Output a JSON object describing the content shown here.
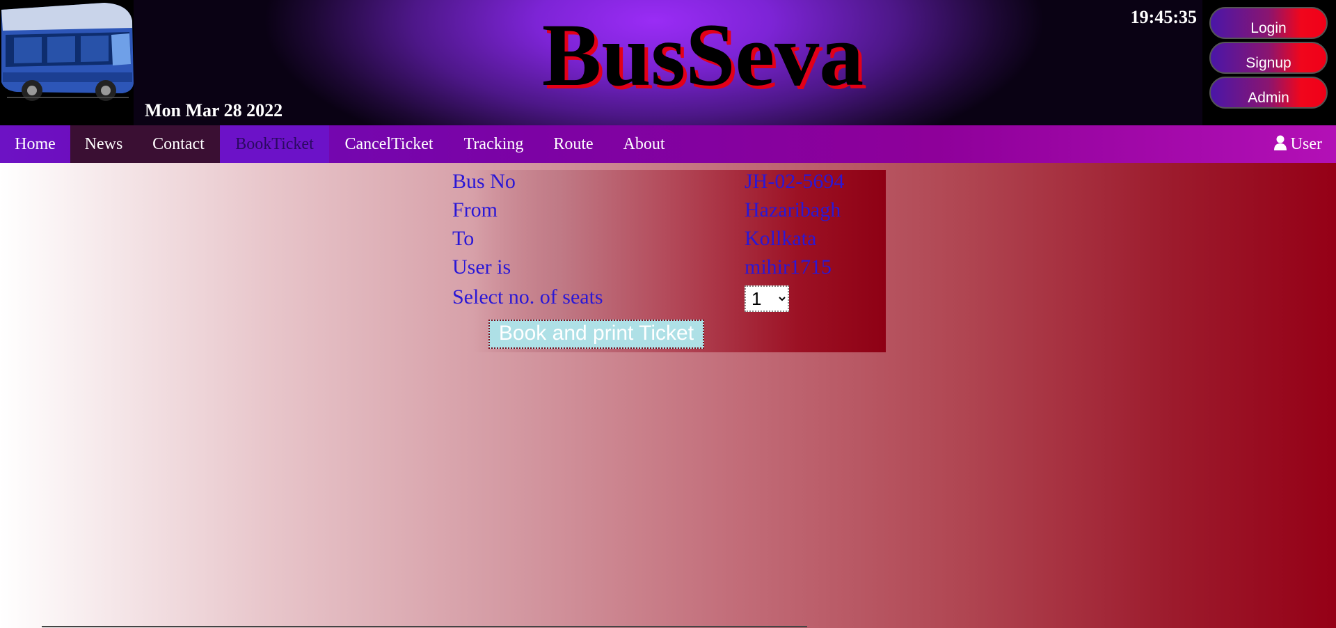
{
  "header": {
    "brand": "BusSeva",
    "date": "Mon Mar 28 2022",
    "clock": "19:45:35",
    "logo_icon": "bus-icon"
  },
  "auth": {
    "login": "Login",
    "signup": "Signup",
    "admin": "Admin"
  },
  "nav": {
    "items": [
      {
        "label": "Home"
      },
      {
        "label": "News"
      },
      {
        "label": "Contact"
      },
      {
        "label": "BookTicket"
      },
      {
        "label": "CancelTicket"
      },
      {
        "label": "Tracking"
      },
      {
        "label": "Route"
      },
      {
        "label": "About"
      }
    ],
    "active": "BookTicket",
    "user_label": "User",
    "user_icon": "user-icon"
  },
  "booking": {
    "rows": [
      {
        "label": "Bus No",
        "value": "JH-02-5694"
      },
      {
        "label": "From",
        "value": "Hazaribagh"
      },
      {
        "label": "To",
        "value": "Kollkata"
      },
      {
        "label": "User is",
        "value": "mihir1715"
      }
    ],
    "seats_label": "Select no. of seats",
    "seats_value": "1",
    "submit_label": "Book and print Ticket"
  },
  "colors": {
    "brand_text": "#000000",
    "brand_shadow": "#e30018",
    "form_text": "#2a17d6",
    "button_bg": "#aee0e6",
    "nav_active_bg": "#6c12c8"
  }
}
